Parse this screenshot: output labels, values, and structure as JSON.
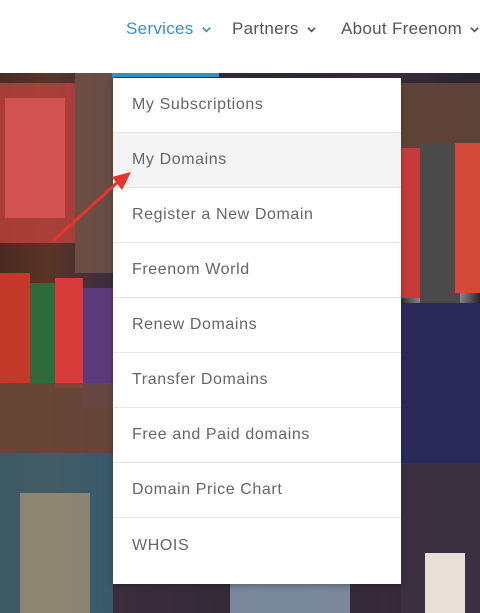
{
  "nav": {
    "items": [
      {
        "label": "Services"
      },
      {
        "label": "Partners"
      },
      {
        "label": "About Freenom"
      }
    ]
  },
  "dropdown": {
    "items": [
      {
        "label": "My Subscriptions"
      },
      {
        "label": "My Domains"
      },
      {
        "label": "Register a New Domain"
      },
      {
        "label": "Freenom World"
      },
      {
        "label": "Renew Domains"
      },
      {
        "label": "Transfer Domains"
      },
      {
        "label": "Free and Paid domains"
      },
      {
        "label": "Domain Price Chart"
      },
      {
        "label": "WHOIS"
      }
    ]
  },
  "colors": {
    "accent": "#3a8ec9",
    "annotation_arrow": "#e8352b"
  }
}
